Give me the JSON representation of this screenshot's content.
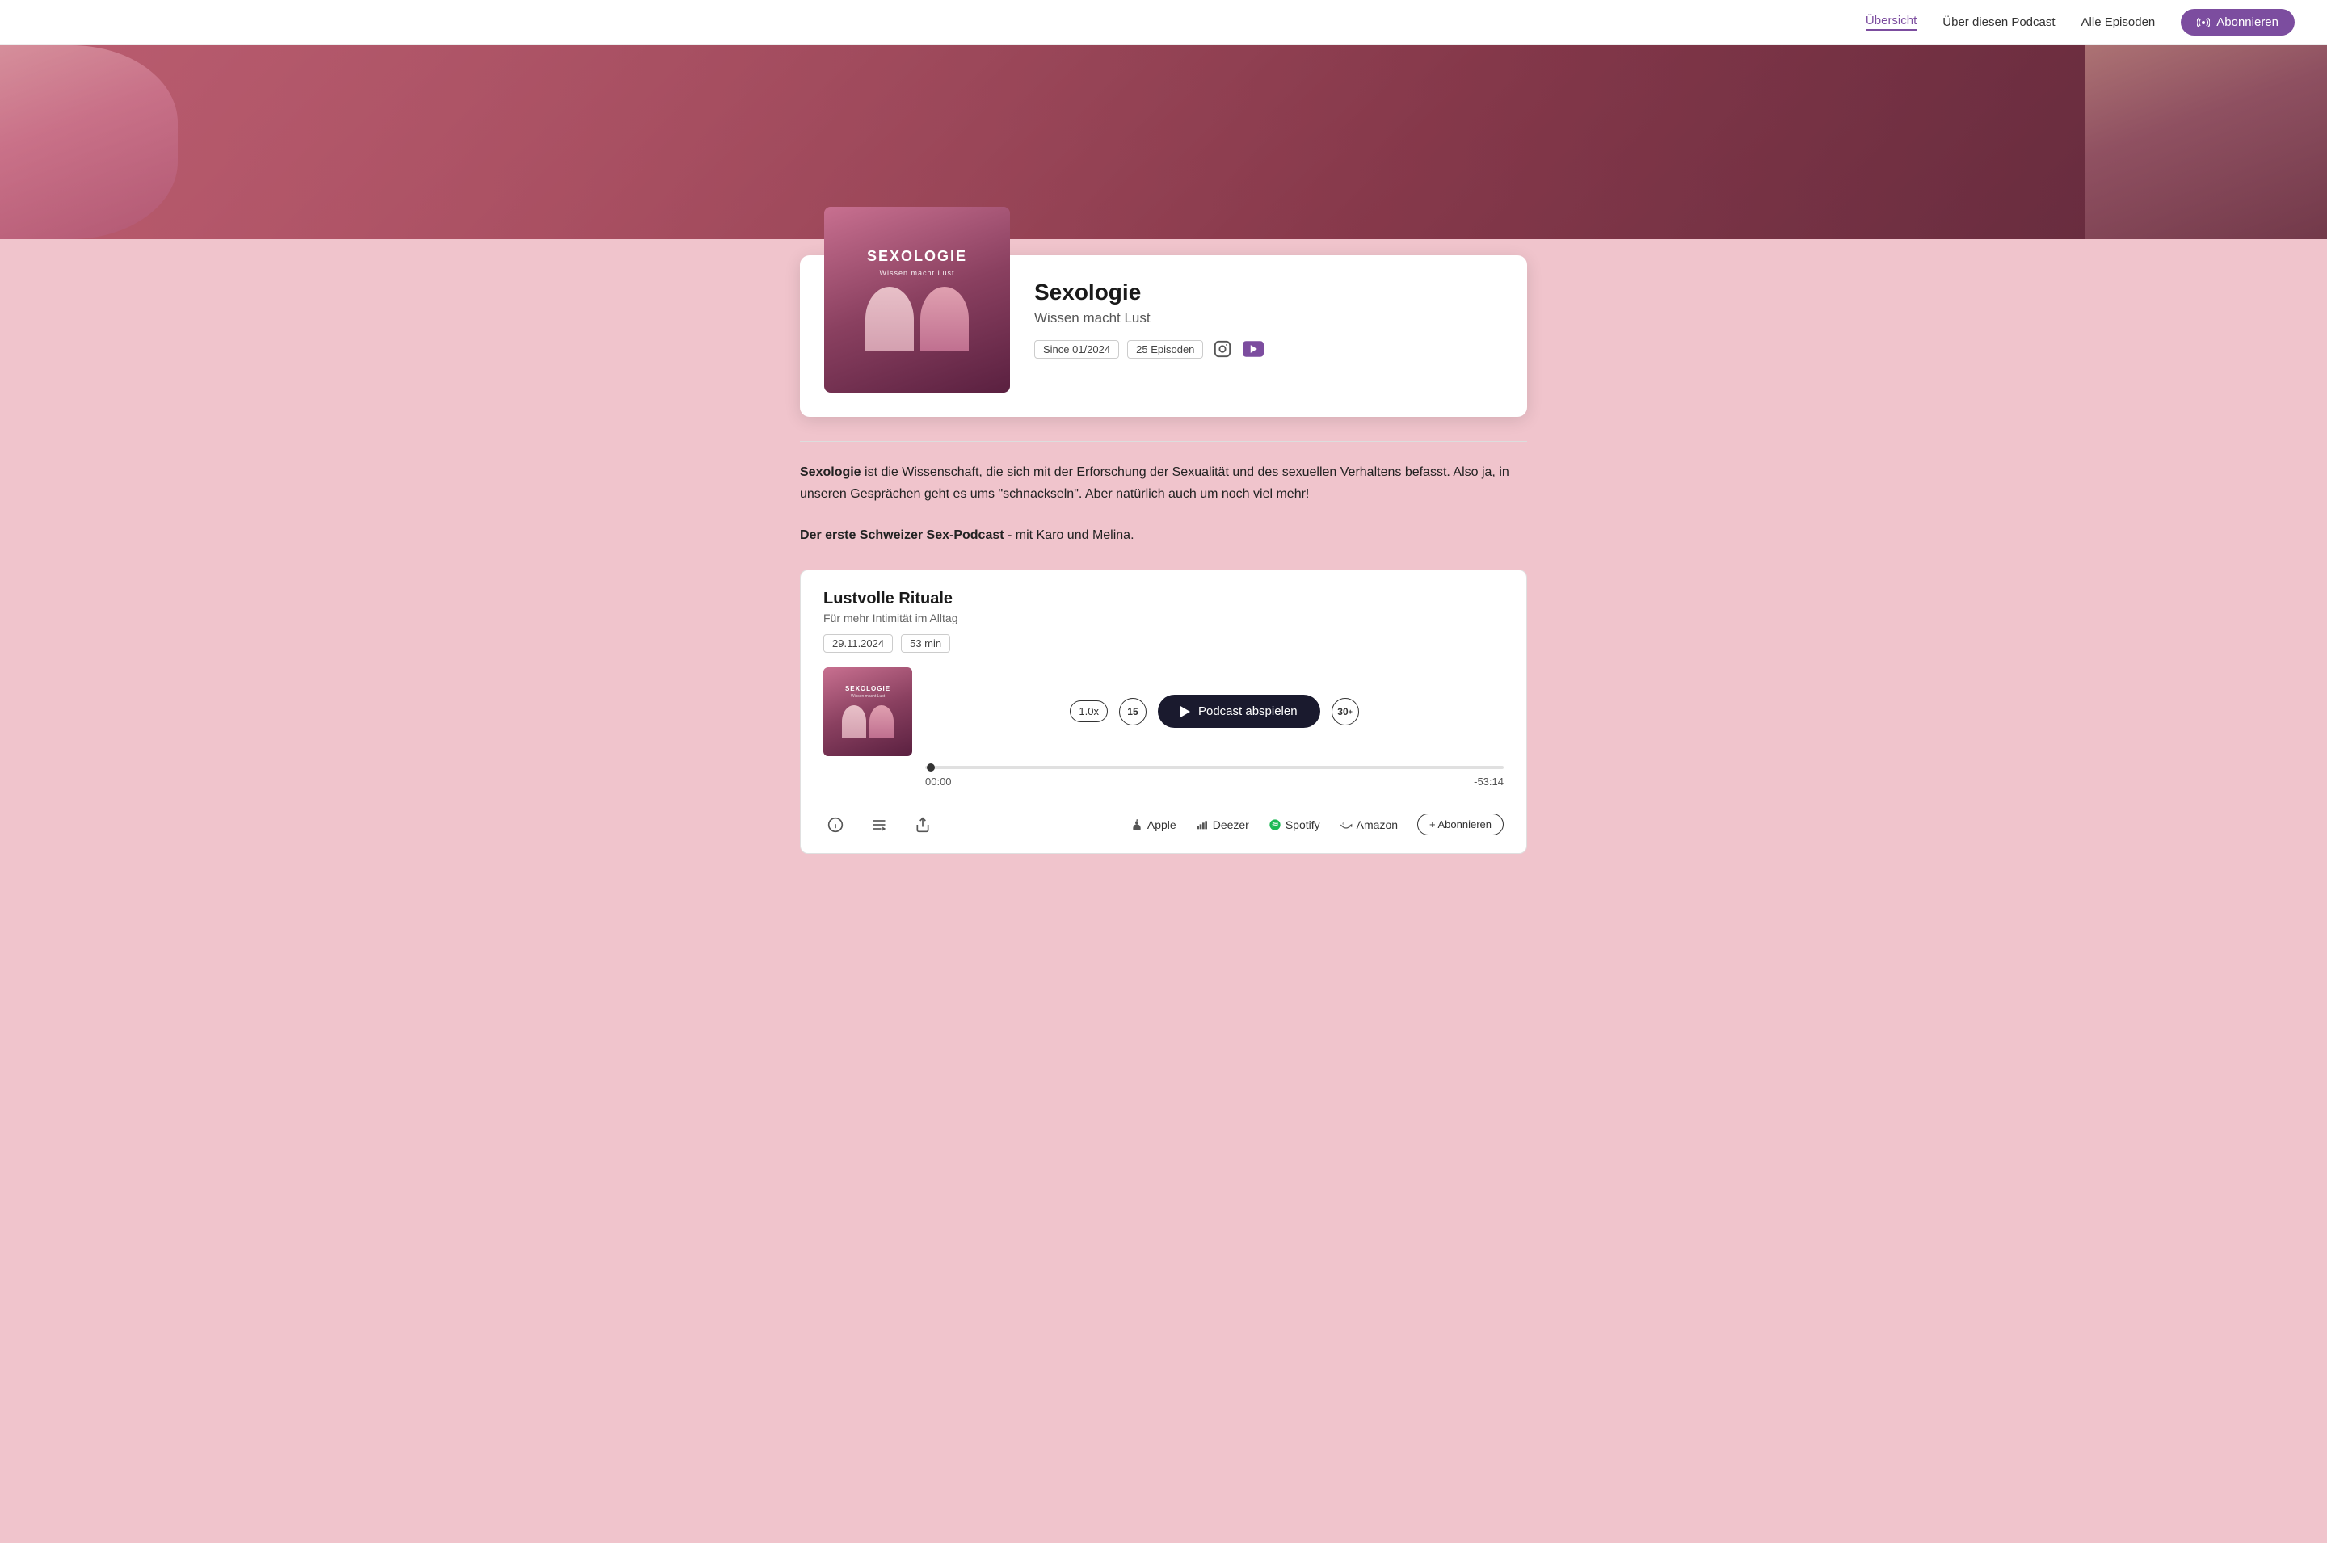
{
  "nav": {
    "links": [
      {
        "id": "uebersicht",
        "label": "Übersicht",
        "active": true
      },
      {
        "id": "ueber",
        "label": "Über diesen Podcast",
        "active": false
      },
      {
        "id": "episoden",
        "label": "Alle Episoden",
        "active": false
      }
    ],
    "subscribe_label": "Abonnieren"
  },
  "podcast": {
    "title": "Sexologie",
    "tagline": "Wissen macht Lust",
    "cover_title": "SEXOLOGIE",
    "cover_subtitle": "Wissen macht Lust",
    "since_badge": "Since 01/2024",
    "episodes_badge": "25 Episoden"
  },
  "description": {
    "bold_part": "Sexologie",
    "text": " ist die Wissenschaft, die sich mit der Erforschung der Sexualität und des sexuellen Verhaltens befasst. Also ja, in unseren Gesprächen geht es ums \"schnackseln\". Aber natürlich auch um noch viel mehr!"
  },
  "tagline_section": {
    "bold_part": "Der erste Schweizer Sex-Podcast",
    "text": " - mit Karo und Melina."
  },
  "episode": {
    "title": "Lustvolle Rituale",
    "subtitle": "Für mehr Intimität im Alltag",
    "date_badge": "29.11.2024",
    "duration_badge": "53 min",
    "speed_label": "1.0x",
    "skip_back_label": "15",
    "play_label": "Podcast abspielen",
    "skip_forward_label": "30",
    "time_current": "00:00",
    "time_remaining": "-53:14",
    "thumb_title": "SEXOLOGIE",
    "thumb_sub": "Wissen macht Lust"
  },
  "bottom_bar": {
    "info_label": "ℹ",
    "playlist_label": "≡",
    "share_label": "↗",
    "platforms": [
      {
        "id": "apple",
        "label": "Apple",
        "icon": "🎙"
      },
      {
        "id": "deezer",
        "label": "Deezer",
        "icon": "📊"
      },
      {
        "id": "spotify",
        "label": "Spotify",
        "icon": "🎵"
      },
      {
        "id": "amazon",
        "label": "Amazon",
        "icon": "🔊"
      }
    ],
    "subscribe_label": "+ Abonnieren"
  }
}
